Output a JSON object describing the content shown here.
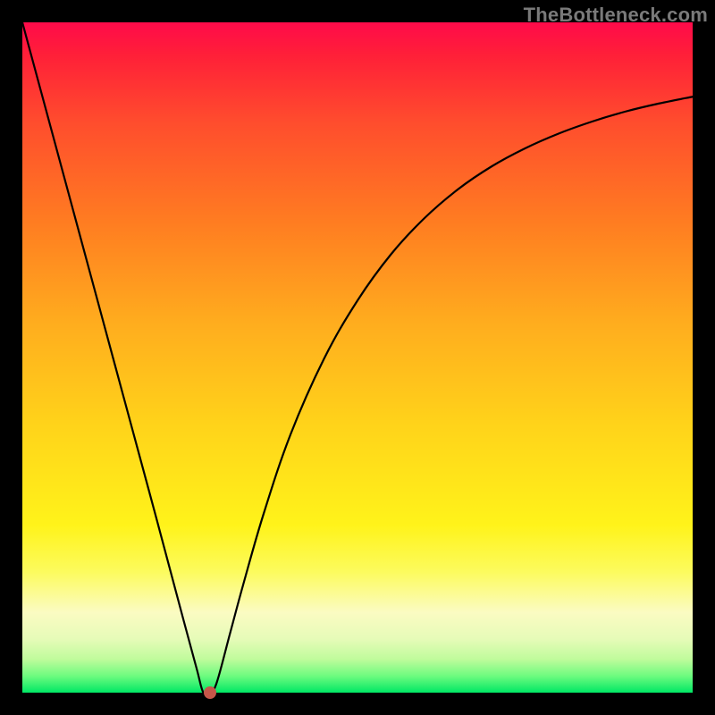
{
  "watermark": "TheBottleneck.com",
  "chart_data": {
    "type": "line",
    "title": "",
    "xlabel": "",
    "ylabel": "",
    "xlim": [
      0,
      100
    ],
    "ylim": [
      0,
      100
    ],
    "background_gradient": {
      "top": "#ff0a4a",
      "bottom": "#00e865",
      "stops": [
        "red",
        "orange",
        "yellow",
        "green"
      ]
    },
    "series": [
      {
        "name": "bottleneck-curve",
        "x": [
          0,
          5,
          10,
          15,
          20,
          24,
          26,
          27,
          28,
          29,
          31,
          33,
          36,
          40,
          45,
          50,
          55,
          60,
          65,
          70,
          75,
          80,
          85,
          90,
          95,
          100
        ],
        "values": [
          100,
          81.5,
          63.0,
          44.5,
          26.0,
          11.0,
          3.6,
          0.0,
          0.0,
          1.5,
          8.9,
          16.3,
          26.7,
          38.5,
          49.8,
          58.5,
          65.4,
          70.8,
          75.1,
          78.5,
          81.2,
          83.4,
          85.2,
          86.7,
          87.9,
          88.9
        ]
      }
    ],
    "marker": {
      "x": 28,
      "y": 0,
      "color": "#c65649"
    }
  }
}
